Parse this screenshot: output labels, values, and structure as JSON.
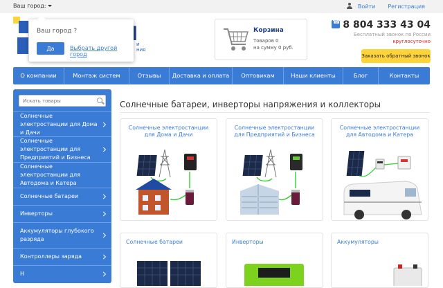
{
  "topbar": {
    "city_label": "Ваш город:",
    "login": "Войти",
    "register": "Регистрация"
  },
  "brand": {
    "logo_text": "Н",
    "logo_sub_1": "и",
    "logo_sub_2": "ния"
  },
  "city_popup": {
    "question": "Ваш город ?",
    "yes": "Да",
    "other": "Выбрать другой город"
  },
  "cart": {
    "title": "Корзина",
    "items": "Товаров 0",
    "sum": "на сумму 0 руб."
  },
  "contact": {
    "phone": "8 804 333 43 04",
    "free_call": "Бесплатный звонок по России",
    "hours": "круглосуточно",
    "callback_button": "Заказать обратный звонок"
  },
  "nav": [
    {
      "label": "О компании"
    },
    {
      "label": "Монтаж систем"
    },
    {
      "label": "Отзывы"
    },
    {
      "label": "Доставка и оплата"
    },
    {
      "label": "Оптовикам"
    },
    {
      "label": "Наши клиенты"
    },
    {
      "label": "Блог"
    },
    {
      "label": "Контакты"
    }
  ],
  "sidebar": {
    "search_placeholder": "Искать товары",
    "items": [
      {
        "label": "Солнечные электростанции для Дома и Дачи"
      },
      {
        "label": "Солнечные электростанции для Предприятий и Бизнеса"
      },
      {
        "label": "Солнечные электростанции для Автодома и Катера"
      },
      {
        "label": "Солнечные батареи"
      },
      {
        "label": "Инверторы"
      },
      {
        "label": "Аккумуляторы глубокого разряда"
      },
      {
        "label": "Контроллеры заряда"
      },
      {
        "label": "Н"
      }
    ]
  },
  "main": {
    "title": "Солнечные батареи, инверторы напряжения и коллекторы",
    "cards": [
      {
        "title": "Солнечные электростанции для Дома и Дачи"
      },
      {
        "title": "Солнечные электростанции для Предприятий и Бизнеса"
      },
      {
        "title": "Солнечные электростанции для Автодома и Катера"
      },
      {
        "title": "Солнечные батареи"
      },
      {
        "title": "Инверторы"
      },
      {
        "title": "Аккумуляторы"
      }
    ]
  },
  "colors": {
    "primary": "#3a7bd5",
    "accent": "#ffd43a",
    "brand_dark": "#1e3f8c",
    "alert": "#e02020"
  }
}
